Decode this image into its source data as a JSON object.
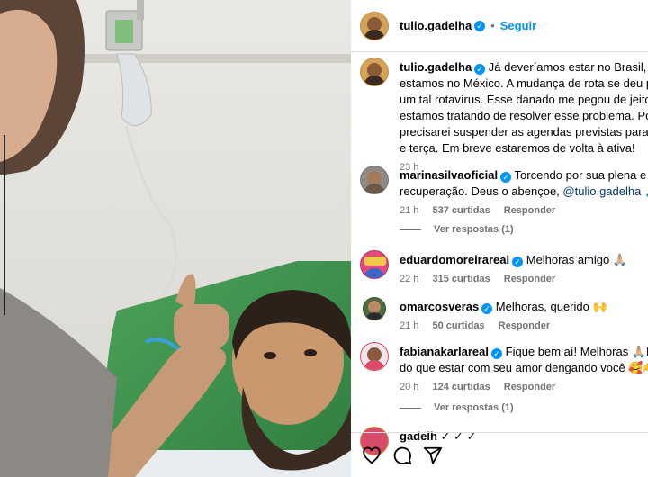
{
  "post": {
    "username": "tulio.gadelha",
    "follow_label": "Seguir",
    "dot": "•",
    "verified_glyph": "✓",
    "caption_lines": [
      "Já deveríamos estar no Brasil, mas ain",
      "estamos no México. A mudança de rota se deu por co",
      "um tal rotavírus. Esse danado me pegou de jeito. Mas j",
      "estamos tratando de resolver esse problema. Por enqu",
      "precisarei suspender as agendas previstas para hoje, a",
      "e terça. Em breve estaremos de volta à ativa!"
    ],
    "time": "23 h"
  },
  "comments": [
    {
      "username": "marinasilvaoficial",
      "verified": true,
      "text_lines": [
        "Torcendo por sua plena e rápida",
        "recuperação. Deus o abençoe, "
      ],
      "mention": "@tulio.gadelha",
      "emoji": "🙏🏾",
      "time": "21 h",
      "likes": "537 curtidas",
      "reply": "Responder",
      "see_replies": "Ver respostas (1)"
    },
    {
      "username": "eduardomoreirareal",
      "verified": true,
      "text": "Melhoras amigo 🙏🏼",
      "time": "22 h",
      "likes": "315 curtidas",
      "reply": "Responder"
    },
    {
      "username": "omarcosveras",
      "verified": true,
      "text": "Melhoras, querido 🙌",
      "time": "21 h",
      "likes": "50 curtidas",
      "reply": "Responder"
    },
    {
      "username": "fabianakarlareal",
      "verified": true,
      "text_lines": [
        "Fique bem aí! Melhoras 🙏🏼E nada m",
        "do que estar com seu amor dengando você 🥰🫶✨"
      ],
      "time": "20 h",
      "likes": "124 curtidas",
      "reply": "Responder",
      "see_replies": "Ver respostas (1)"
    },
    {
      "username": "gadelh",
      "text": "✓ ✓ ✓"
    }
  ],
  "actions": {
    "like_icon": "heart-icon",
    "comment_icon": "comment-icon",
    "share_icon": "share-icon"
  },
  "colors": {
    "accent": "#0095f6",
    "mention": "#00376b",
    "muted": "#737373",
    "border": "#dbdbdb"
  }
}
